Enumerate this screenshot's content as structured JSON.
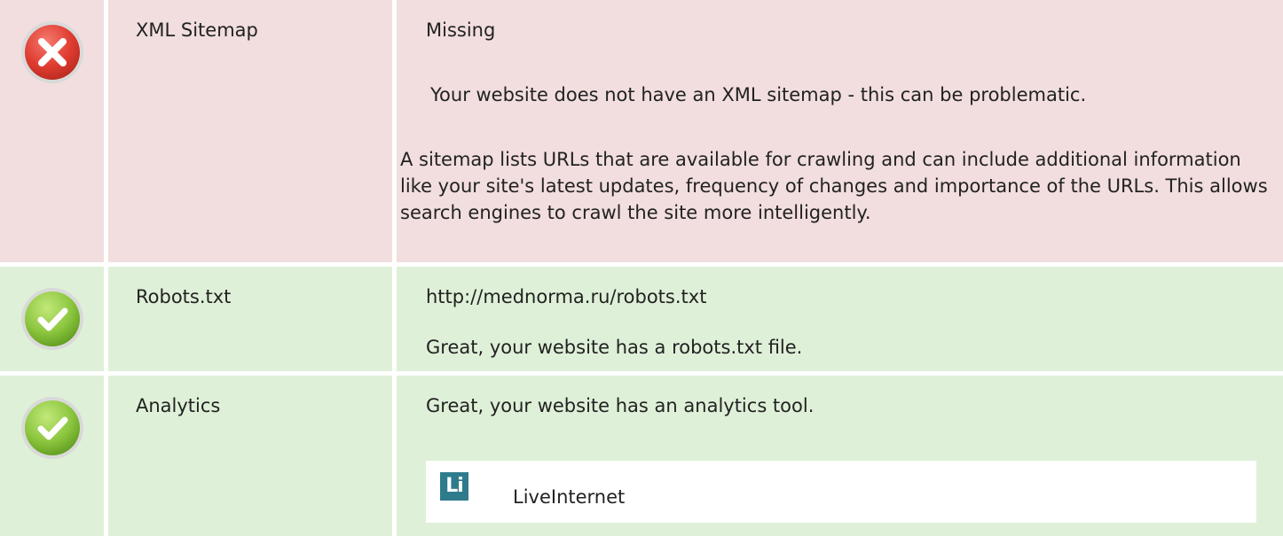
{
  "rows": [
    {
      "status": "error",
      "status_icon": "error-x-icon",
      "label": "XML Sitemap",
      "value": "Missing",
      "message": "Your website does not have an XML sitemap - this can be problematic.",
      "description": "A sitemap lists URLs that are available for crawling and can include additional information like your site's latest updates, frequency of changes and importance of the URLs. This allows search engines to crawl the site more intelligently."
    },
    {
      "status": "success",
      "status_icon": "success-check-icon",
      "label": "Robots.txt",
      "value": "http://mednorma.ru/robots.txt",
      "message": "Great, your website has a robots.txt file."
    },
    {
      "status": "success",
      "status_icon": "success-check-icon",
      "label": "Analytics",
      "message": "Great, your website has an analytics tool.",
      "tools": [
        {
          "logo_text": "Li",
          "name": "LiveInternet"
        }
      ]
    }
  ],
  "colors": {
    "error_row_bg": "#f2dede",
    "success_row_bg": "#dff0d8",
    "error_icon": "#e03c31",
    "success_icon": "#8cc63f"
  }
}
